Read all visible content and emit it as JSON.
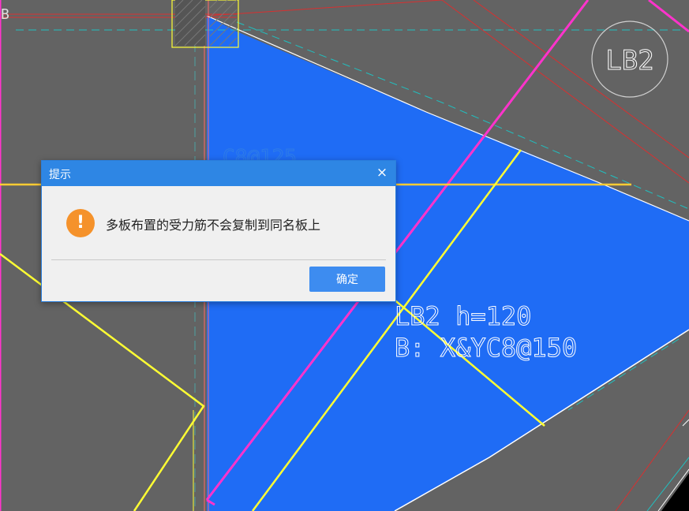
{
  "drawing": {
    "slab_circle_label": "LB2",
    "slab_label_line1": "LB2 h=120",
    "slab_label_line2": "B: X&YC8@150",
    "partial_label": "C8@125",
    "edge_glyph": "B",
    "colors": {
      "background": "#636363",
      "slab_fill": "#1f6cf5",
      "magenta": "#ff33cc",
      "yellow": "#ffff33",
      "red": "#e03030",
      "cyan": "#20c0c0",
      "white": "#ffffff"
    }
  },
  "dialog": {
    "title": "提示",
    "close_glyph": "×",
    "icon": "exclamation-circle-icon",
    "icon_glyph": "!",
    "message": "多板布置的受力筋不会复制到同名板上",
    "ok_label": "确定"
  }
}
